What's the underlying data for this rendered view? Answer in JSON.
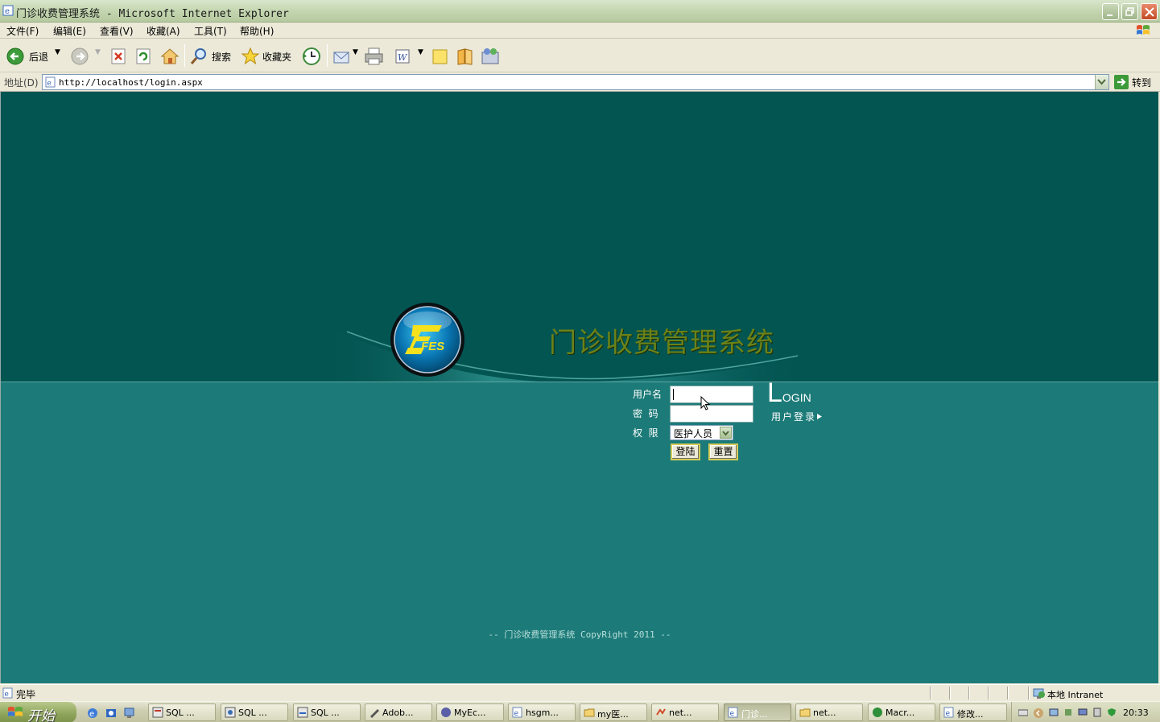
{
  "window": {
    "title": "门诊收费管理系统 - Microsoft Internet Explorer"
  },
  "menu": [
    "文件(F)",
    "编辑(E)",
    "查看(V)",
    "收藏(A)",
    "工具(T)",
    "帮助(H)"
  ],
  "toolbar": {
    "back_label": "后退",
    "search_label": "搜索",
    "favorites_label": "收藏夹"
  },
  "address": {
    "label": "地址(D)",
    "url": "http://localhost/login.aspx",
    "go_label": "转到"
  },
  "page": {
    "system_title": "门诊收费管理系统",
    "logo_text": "FES",
    "username_label": "用户名",
    "password_label": "密  码",
    "role_label": "权  限",
    "username_value": "",
    "password_value": "",
    "role_selected": "医护人员",
    "login_button": "登陆",
    "reset_button": "重置",
    "login_title_initial": "L",
    "login_title_rest": "OGIN",
    "login_subtitle": "用户登录",
    "copyright": "-- 门诊收费管理系统 CopyRight 2011 --"
  },
  "status": {
    "text": "完毕",
    "zone": "本地 Intranet"
  },
  "taskbar": {
    "start_label": "开始",
    "tasks": [
      "SQL ...",
      "SQL ...",
      "SQL ...",
      "Adob...",
      "MyEc...",
      "hsgm...",
      "my医...",
      "net...",
      "门诊...",
      "net...",
      "Macr...",
      "修改..."
    ],
    "clock": "20:33"
  },
  "colors": {
    "hero_bg": "#035552",
    "content_bg": "#1c7b78",
    "title_text": "#6a8219"
  }
}
